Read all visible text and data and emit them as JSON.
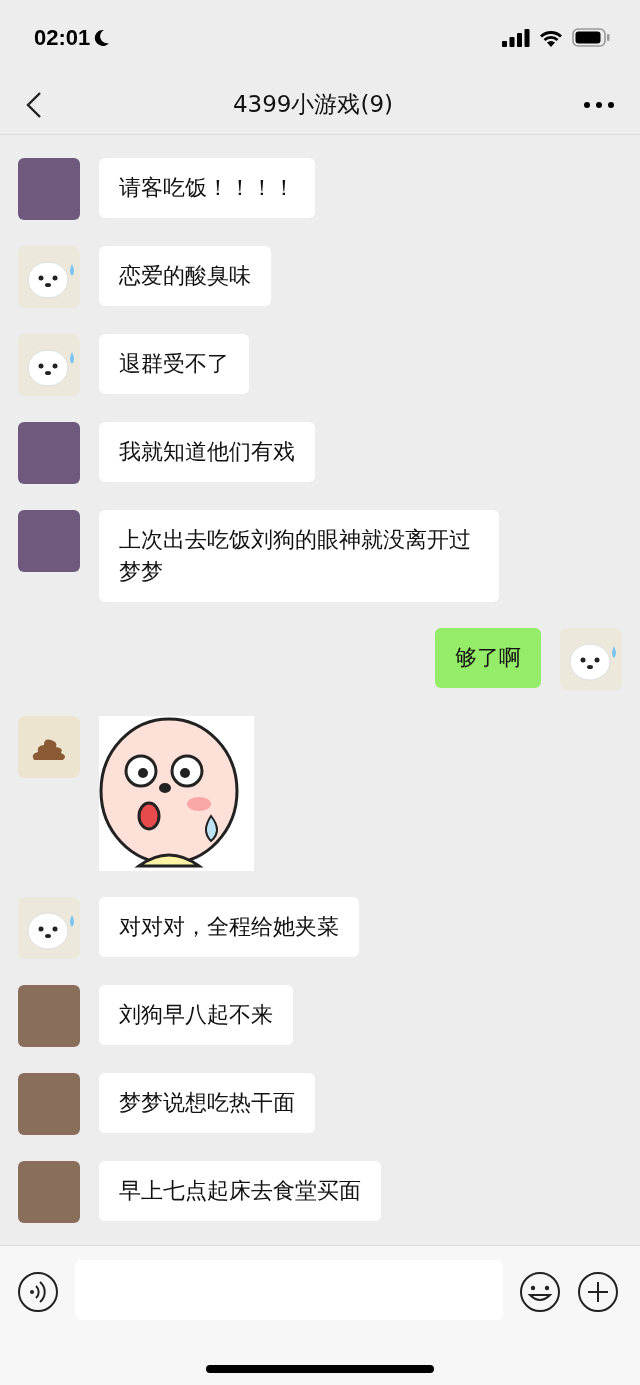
{
  "status_bar": {
    "time": "02:01"
  },
  "header": {
    "title": "4399小游戏(9)"
  },
  "messages": [
    {
      "outgoing": false,
      "kind": "text",
      "avatar": {
        "kind": "character"
      },
      "text": "请客吃饭！！！！"
    },
    {
      "outgoing": false,
      "kind": "text",
      "avatar": {
        "kind": "puppy"
      },
      "text": "恋爱的酸臭味"
    },
    {
      "outgoing": false,
      "kind": "text",
      "avatar": {
        "kind": "puppy"
      },
      "text": "退群受不了"
    },
    {
      "outgoing": false,
      "kind": "text",
      "avatar": {
        "kind": "character"
      },
      "text": "我就知道他们有戏"
    },
    {
      "outgoing": false,
      "kind": "text",
      "avatar": {
        "kind": "character"
      },
      "text": "上次出去吃饭刘狗的眼神就没离开过梦梦"
    },
    {
      "outgoing": true,
      "kind": "text",
      "avatar": {
        "kind": "puppy"
      },
      "text": "够了啊"
    },
    {
      "outgoing": false,
      "kind": "sticker",
      "avatar": {
        "kind": "poop"
      }
    },
    {
      "outgoing": false,
      "kind": "text",
      "avatar": {
        "kind": "puppy"
      },
      "text": "对对对，全程给她夹菜"
    },
    {
      "outgoing": false,
      "kind": "text",
      "avatar": {
        "kind": "person"
      },
      "text": "刘狗早八起不来"
    },
    {
      "outgoing": false,
      "kind": "text",
      "avatar": {
        "kind": "person"
      },
      "text": "梦梦说想吃热干面"
    },
    {
      "outgoing": false,
      "kind": "text",
      "avatar": {
        "kind": "person"
      },
      "text": "早上七点起床去食堂买面"
    }
  ]
}
